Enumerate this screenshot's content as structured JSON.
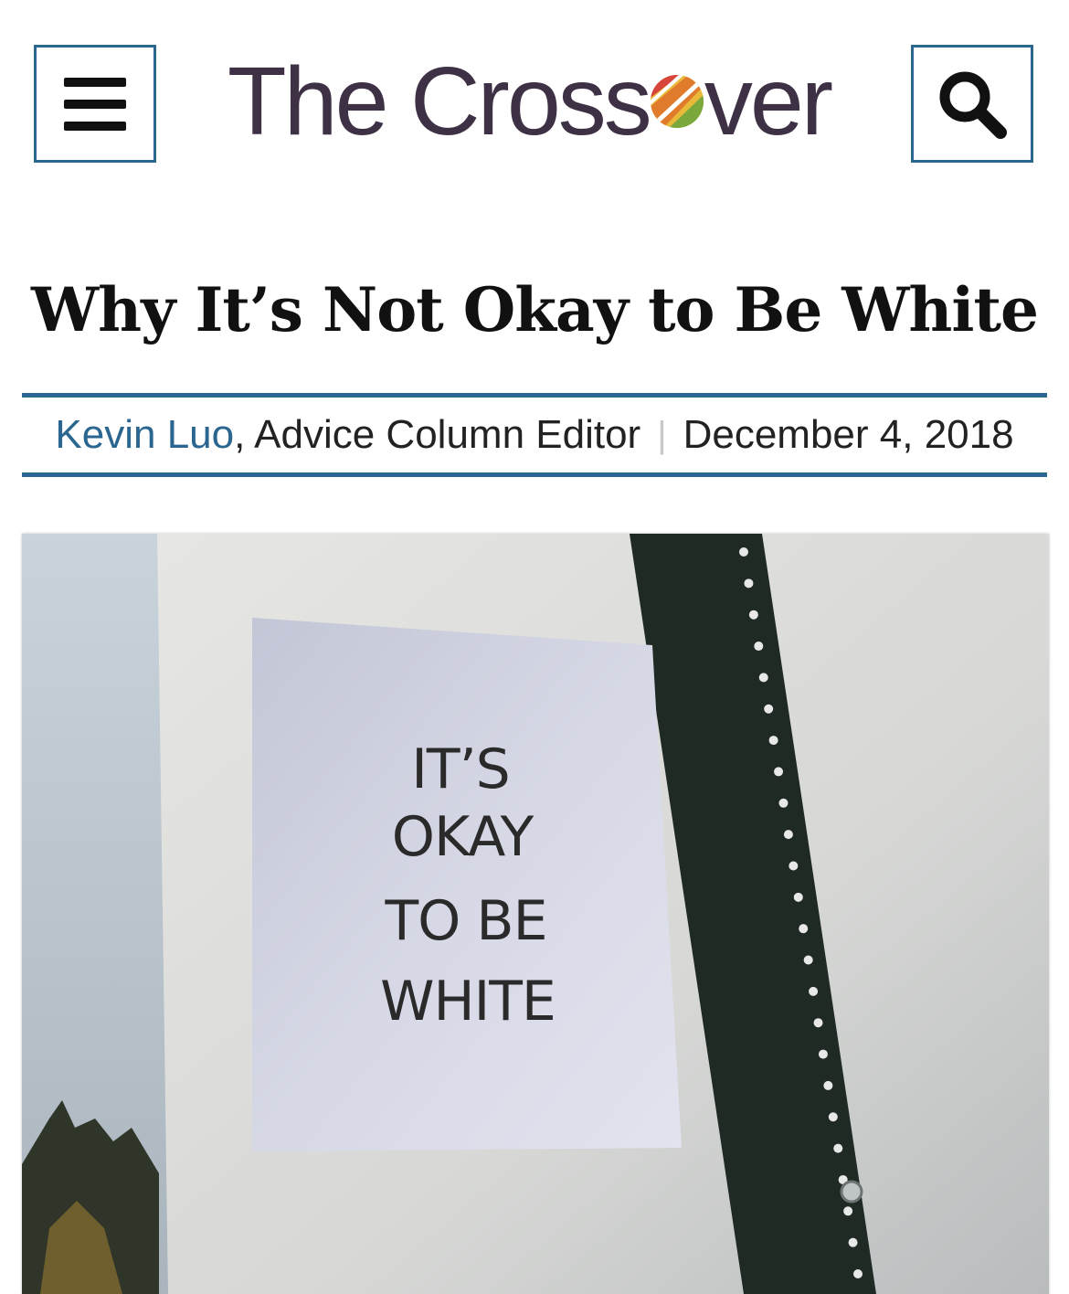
{
  "header": {
    "menu_icon": "hamburger-menu-icon",
    "search_icon": "search-icon",
    "logo_prefix": "The Cross",
    "logo_suffix": "ver",
    "colors": {
      "border": "#2b6690",
      "logo": "#3e3145"
    }
  },
  "article": {
    "title": "Why It’s Not Okay to Be White",
    "author": "Kevin Luo",
    "role": ", Advice Column Editor",
    "separator": "|",
    "date": "December 4, 2018"
  },
  "photo": {
    "poster_lines": [
      "IT’S",
      "OKAY",
      "TO BE",
      "WHITE"
    ]
  }
}
